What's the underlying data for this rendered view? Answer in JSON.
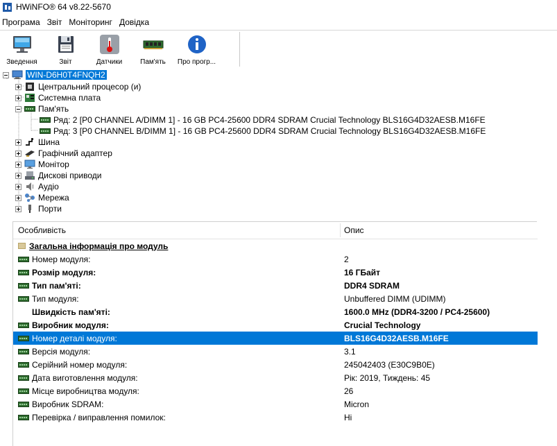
{
  "window": {
    "title": "HWiNFO® 64 v8.22-5670"
  },
  "menu": [
    "Програма",
    "Звіт",
    "Моніторинг",
    "Довідка"
  ],
  "toolbar": [
    {
      "label": "Зведення",
      "icon": "monitor-summary-icon"
    },
    {
      "label": "Звіт",
      "icon": "floppy-report-icon"
    },
    {
      "label": "Датчики",
      "icon": "thermometer-sensors-icon"
    },
    {
      "label": "Пам'ять",
      "icon": "memory-module-icon"
    },
    {
      "label": "Про прогр...",
      "icon": "info-about-icon"
    }
  ],
  "tree": {
    "root": "WIN-D6H0T4FNQH2",
    "items": [
      {
        "label": "Центральний процесор (и)",
        "icon": "cpu-icon"
      },
      {
        "label": "Системна плата",
        "icon": "motherboard-icon"
      },
      {
        "label": "Пам'ять",
        "icon": "memory-icon"
      },
      {
        "label": "Ряд: 2 [P0 CHANNEL A/DIMM 1] - 16 GB PC4-25600 DDR4 SDRAM Crucial Technology BLS16G4D32AESB.M16FE",
        "icon": "memory-module-icon"
      },
      {
        "label": "Ряд: 3 [P0 CHANNEL B/DIMM 1] - 16 GB PC4-25600 DDR4 SDRAM Crucial Technology BLS16G4D32AESB.M16FE",
        "icon": "memory-module-icon"
      },
      {
        "label": "Шина",
        "icon": "bus-icon"
      },
      {
        "label": "Графічний адаптер",
        "icon": "gpu-icon"
      },
      {
        "label": "Монітор",
        "icon": "monitor-icon"
      },
      {
        "label": "Дискові приводи",
        "icon": "disk-drive-icon"
      },
      {
        "label": "Аудіо",
        "icon": "speaker-icon"
      },
      {
        "label": "Мережа",
        "icon": "network-icon"
      },
      {
        "label": "Порти",
        "icon": "usb-port-icon"
      }
    ]
  },
  "grid": {
    "headers": {
      "feature": "Особливість",
      "description": "Опис"
    },
    "section": "Загальна інформація про модуль",
    "rows": [
      {
        "feature": "Номер модуля:",
        "value": "2"
      },
      {
        "feature": "Розмір модуля:",
        "value": "16 ГБайт"
      },
      {
        "feature": "Тип пам'яті:",
        "value": "DDR4 SDRAM"
      },
      {
        "feature": "Тип модуля:",
        "value": "Unbuffered DIMM (UDIMM)"
      },
      {
        "feature": "Швидкість пам'яті:",
        "value": "1600.0 MHz (DDR4-3200 / PC4-25600)"
      },
      {
        "feature": "Виробник модуля:",
        "value": "Crucial Technology"
      },
      {
        "feature": "Номер деталі модуля:",
        "value": "BLS16G4D32AESB.M16FE"
      },
      {
        "feature": "Версія модуля:",
        "value": "3.1"
      },
      {
        "feature": "Серійний номер модуля:",
        "value": "245042403 (E30C9B0E)"
      },
      {
        "feature": "Дата виготовлення модуля:",
        "value": "Рік: 2019, Тиждень: 45"
      },
      {
        "feature": "Місце виробництва модуля:",
        "value": "26"
      },
      {
        "feature": "Виробник SDRAM:",
        "value": "Micron"
      },
      {
        "feature": "Перевірка / виправлення помилок:",
        "value": "Ні"
      }
    ]
  },
  "colors": {
    "selection": "#0078d7",
    "ram_green": "#2e6b2e"
  }
}
